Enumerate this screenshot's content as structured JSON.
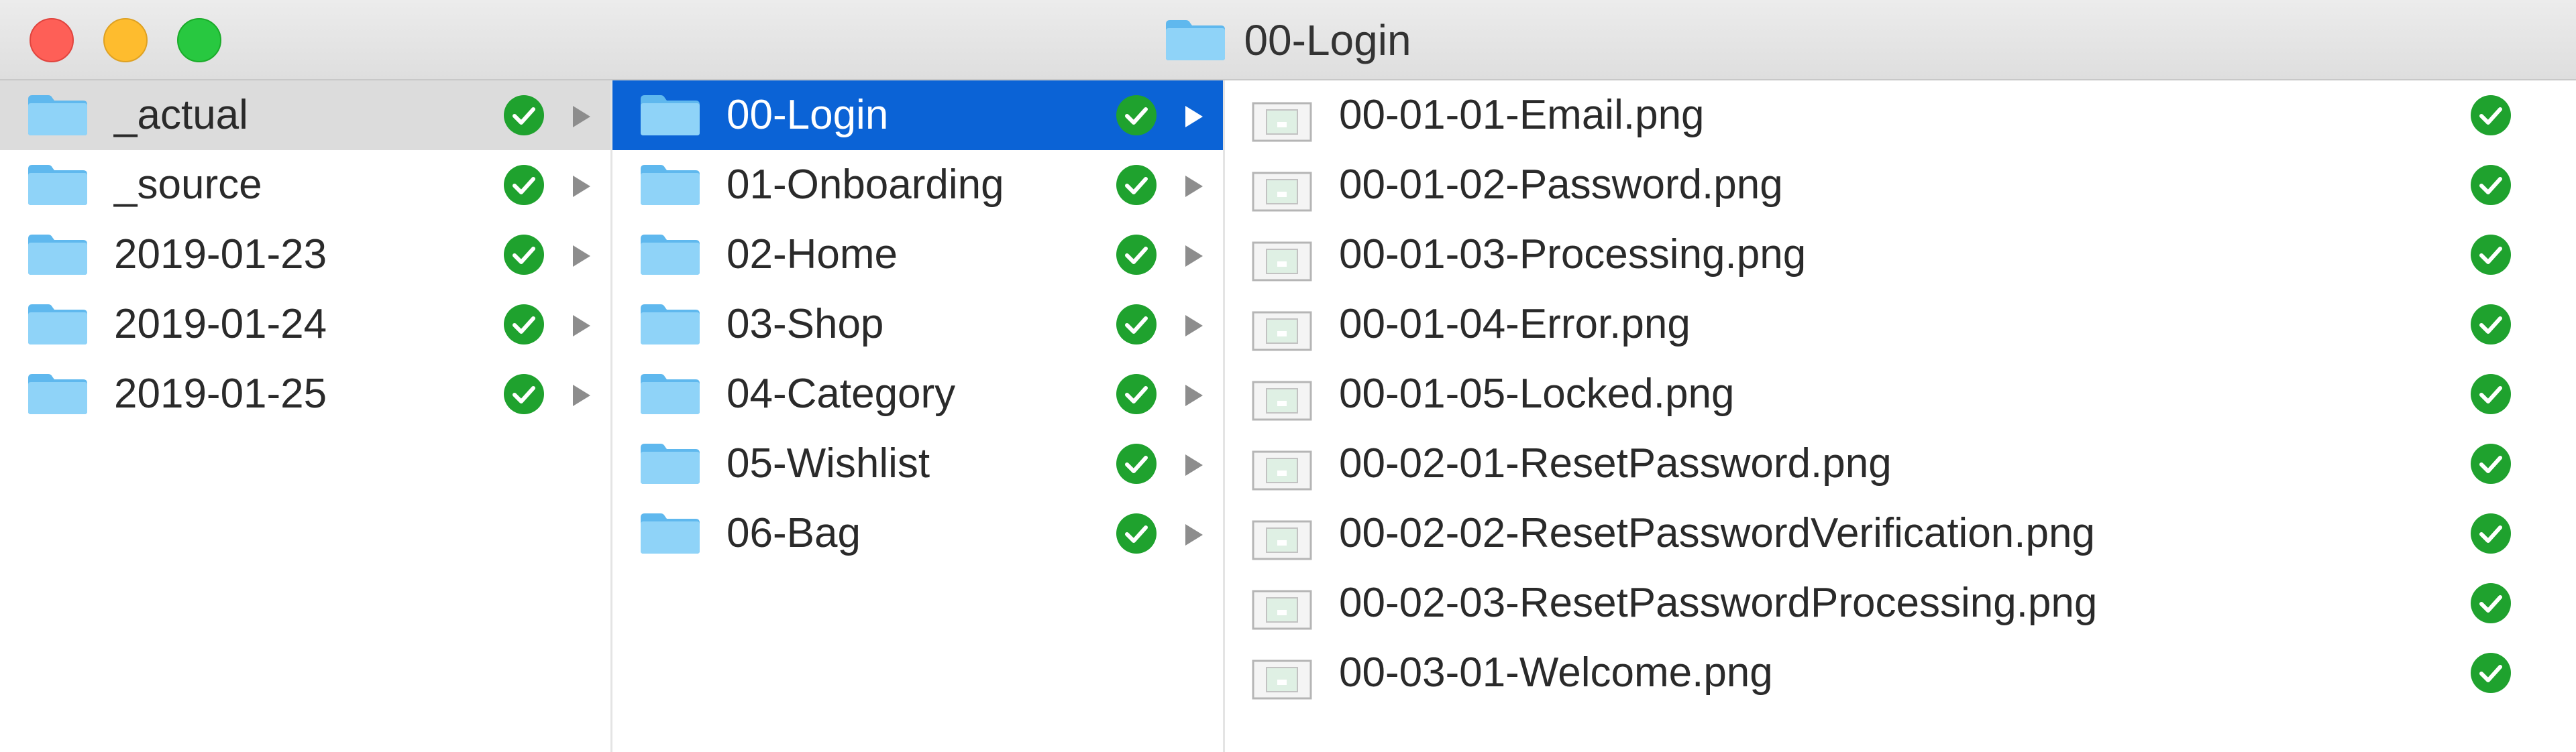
{
  "window": {
    "title": "00-Login"
  },
  "icons": {
    "folder": "folder-icon",
    "image_file": "image-file-icon",
    "synced": "check-circle-icon",
    "disclosure": "chevron-right-icon"
  },
  "colors": {
    "selection_blue": "#0b63d6",
    "selection_gray": "#dcdcdc",
    "synced_green": "#1fa22e",
    "folder_blue": "#6ec3f3"
  },
  "columns": [
    {
      "items": [
        {
          "label": "_actual"
        },
        {
          "label": "_source"
        },
        {
          "label": "2019-01-23"
        },
        {
          "label": "2019-01-24"
        },
        {
          "label": "2019-01-25"
        }
      ]
    },
    {
      "items": [
        {
          "label": "00-Login"
        },
        {
          "label": "01-Onboarding"
        },
        {
          "label": "02-Home"
        },
        {
          "label": "03-Shop"
        },
        {
          "label": "04-Category"
        },
        {
          "label": "05-Wishlist"
        },
        {
          "label": "06-Bag"
        }
      ]
    },
    {
      "items": [
        {
          "label": "00-01-01-Email.png"
        },
        {
          "label": "00-01-02-Password.png"
        },
        {
          "label": "00-01-03-Processing.png"
        },
        {
          "label": "00-01-04-Error.png"
        },
        {
          "label": "00-01-05-Locked.png"
        },
        {
          "label": "00-02-01-ResetPassword.png"
        },
        {
          "label": "00-02-02-ResetPasswordVerification.png"
        },
        {
          "label": "00-02-03-ResetPasswordProcessing.png"
        },
        {
          "label": "00-03-01-Welcome.png"
        }
      ]
    }
  ]
}
